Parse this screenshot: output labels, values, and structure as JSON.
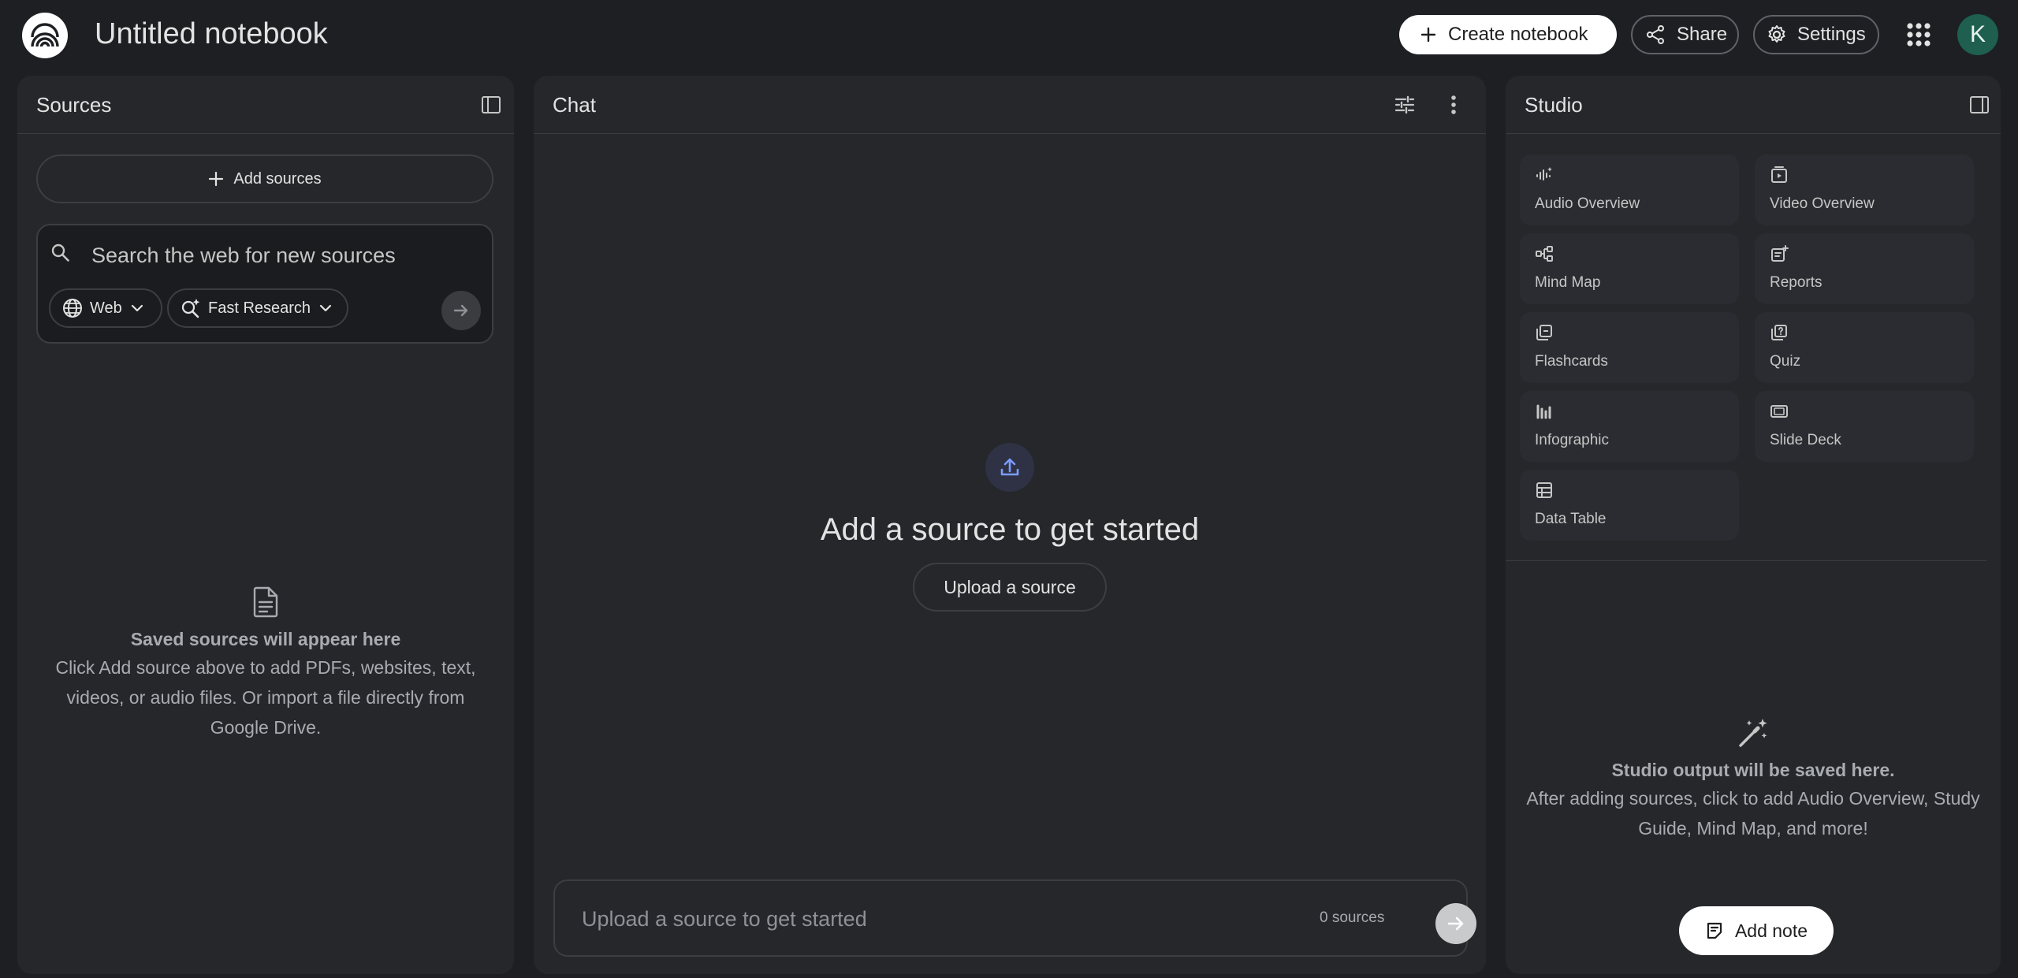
{
  "header": {
    "notebook_title": "Untitled notebook",
    "create_label": "Create notebook",
    "share_label": "Share",
    "settings_label": "Settings",
    "avatar_initial": "K"
  },
  "sources": {
    "title": "Sources",
    "add_label": "Add sources",
    "search_placeholder": "Search the web for new sources",
    "web_chip": "Web",
    "research_chip": "Fast Research",
    "empty_title": "Saved sources will appear here",
    "empty_body": "Click Add source above to add PDFs, websites, text, videos, or audio files. Or import a file directly from Google Drive."
  },
  "chat": {
    "title": "Chat",
    "headline": "Add a source to get started",
    "upload_label": "Upload a source",
    "input_placeholder": "Upload a source to get started",
    "source_count": "0 sources"
  },
  "studio": {
    "title": "Studio",
    "tiles": [
      {
        "label": "Audio Overview",
        "icon": "audio-waveform-icon"
      },
      {
        "label": "Video Overview",
        "icon": "video-icon"
      },
      {
        "label": "Mind Map",
        "icon": "mind-map-icon"
      },
      {
        "label": "Reports",
        "icon": "reports-icon"
      },
      {
        "label": "Flashcards",
        "icon": "flashcards-icon"
      },
      {
        "label": "Quiz",
        "icon": "quiz-icon"
      },
      {
        "label": "Infographic",
        "icon": "infographic-icon"
      },
      {
        "label": "Slide Deck",
        "icon": "slide-deck-icon"
      },
      {
        "label": "Data Table",
        "icon": "data-table-icon"
      }
    ],
    "empty_title": "Studio output will be saved here.",
    "empty_body": "After adding sources, click to add Audio Overview, Study Guide, Mind Map, and more!",
    "add_note_label": "Add note"
  },
  "colors": {
    "background": "#1d1f23",
    "panel": "#25272b",
    "accent_blue": "#7c9cff",
    "avatar": "#1e5f4f"
  }
}
